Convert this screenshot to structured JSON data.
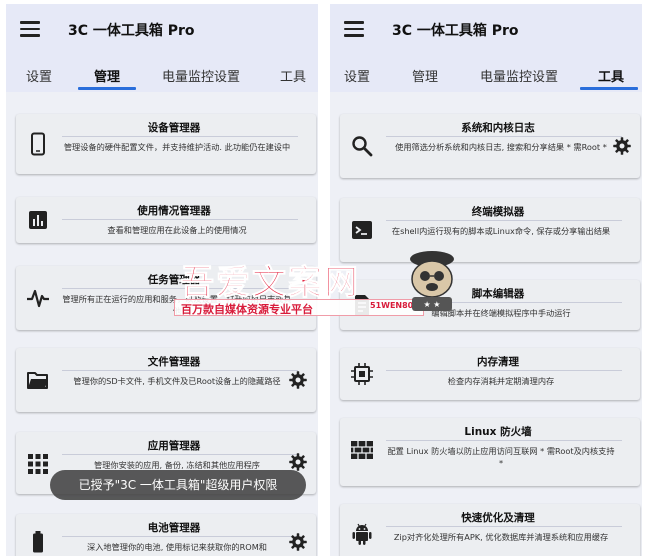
{
  "app": {
    "title": "3C 一体工具箱 Pro"
  },
  "left": {
    "tabs": [
      "设置",
      "管理",
      "电量监控设置",
      "工具"
    ],
    "active_tab": "管理",
    "cards": [
      {
        "title": "设备管理器",
        "desc": "管理设备的硬件配置文件，并支持维护活动. 此功能仍在建设中",
        "icon": "phone-icon",
        "gear": false
      },
      {
        "title": "使用情况管理器",
        "desc": "查看和管理应用在此设备上的使用情况",
        "icon": "bar-chart-icon",
        "gear": false
      },
      {
        "title": "任务管理器",
        "desc": "管理所有正在运行的应用和服务，以及设置、打开应用日志或其他",
        "icon": "activity-icon",
        "gear": false
      },
      {
        "title": "文件管理器",
        "desc": "管理你的SD卡文件, 手机文件及已Root设备上的隐藏路径",
        "icon": "folder-icon",
        "gear": true
      },
      {
        "title": "应用管理器",
        "desc": "管理你安装的应用, 备份, 冻结和其他应用程序",
        "icon": "apps-grid-icon",
        "gear": true
      },
      {
        "title": "电池管理器",
        "desc": "深入地管理你的电池, 使用标记来获取你的ROM和",
        "icon": "battery-icon",
        "gear": true
      }
    ],
    "toast": "已授予\"3C 一体工具箱\"超级用户权限"
  },
  "right": {
    "tabs": [
      "设置",
      "管理",
      "电量监控设置",
      "工具"
    ],
    "active_tab": "工具",
    "cards": [
      {
        "title": "系统和内核日志",
        "desc": "使用筛选分析系统和内核日志, 搜索和分享结果 * 需Root *",
        "icon": "search-icon",
        "gear": true
      },
      {
        "title": "终端模拟器",
        "desc": "在shell内运行现有的脚本或Linux命令, 保存或分享输出结果",
        "icon": "terminal-icon",
        "gear": false
      },
      {
        "title": "脚本编辑器",
        "desc": "编辑脚本并在终端模拟程序中手动运行",
        "icon": "script-icon",
        "gear": false
      },
      {
        "title": "内存清理",
        "desc": "检查内存消耗并定期清理内存",
        "icon": "memory-chip-icon",
        "gear": false
      },
      {
        "title": "Linux 防火墙",
        "desc": "配置 Linux 防火墙以防止应用访问互联网 * 需Root及内核支持 *",
        "icon": "firewall-icon",
        "gear": false
      },
      {
        "title": "快速优化及清理",
        "desc": "Zip对齐化处理所有APK, 优化数据库并清理系统和应用缓存",
        "icon": "android-icon",
        "gear": false
      }
    ]
  },
  "watermark": {
    "title": "吾爱文案网",
    "subtitle": "百万款自媒体资源专业平台",
    "url": "51WEN80.COM"
  },
  "colors": {
    "accent": "#2a6edb",
    "appbar": "#e6e9f7",
    "card": "#eceef1",
    "watermark": "#e31e3b"
  }
}
